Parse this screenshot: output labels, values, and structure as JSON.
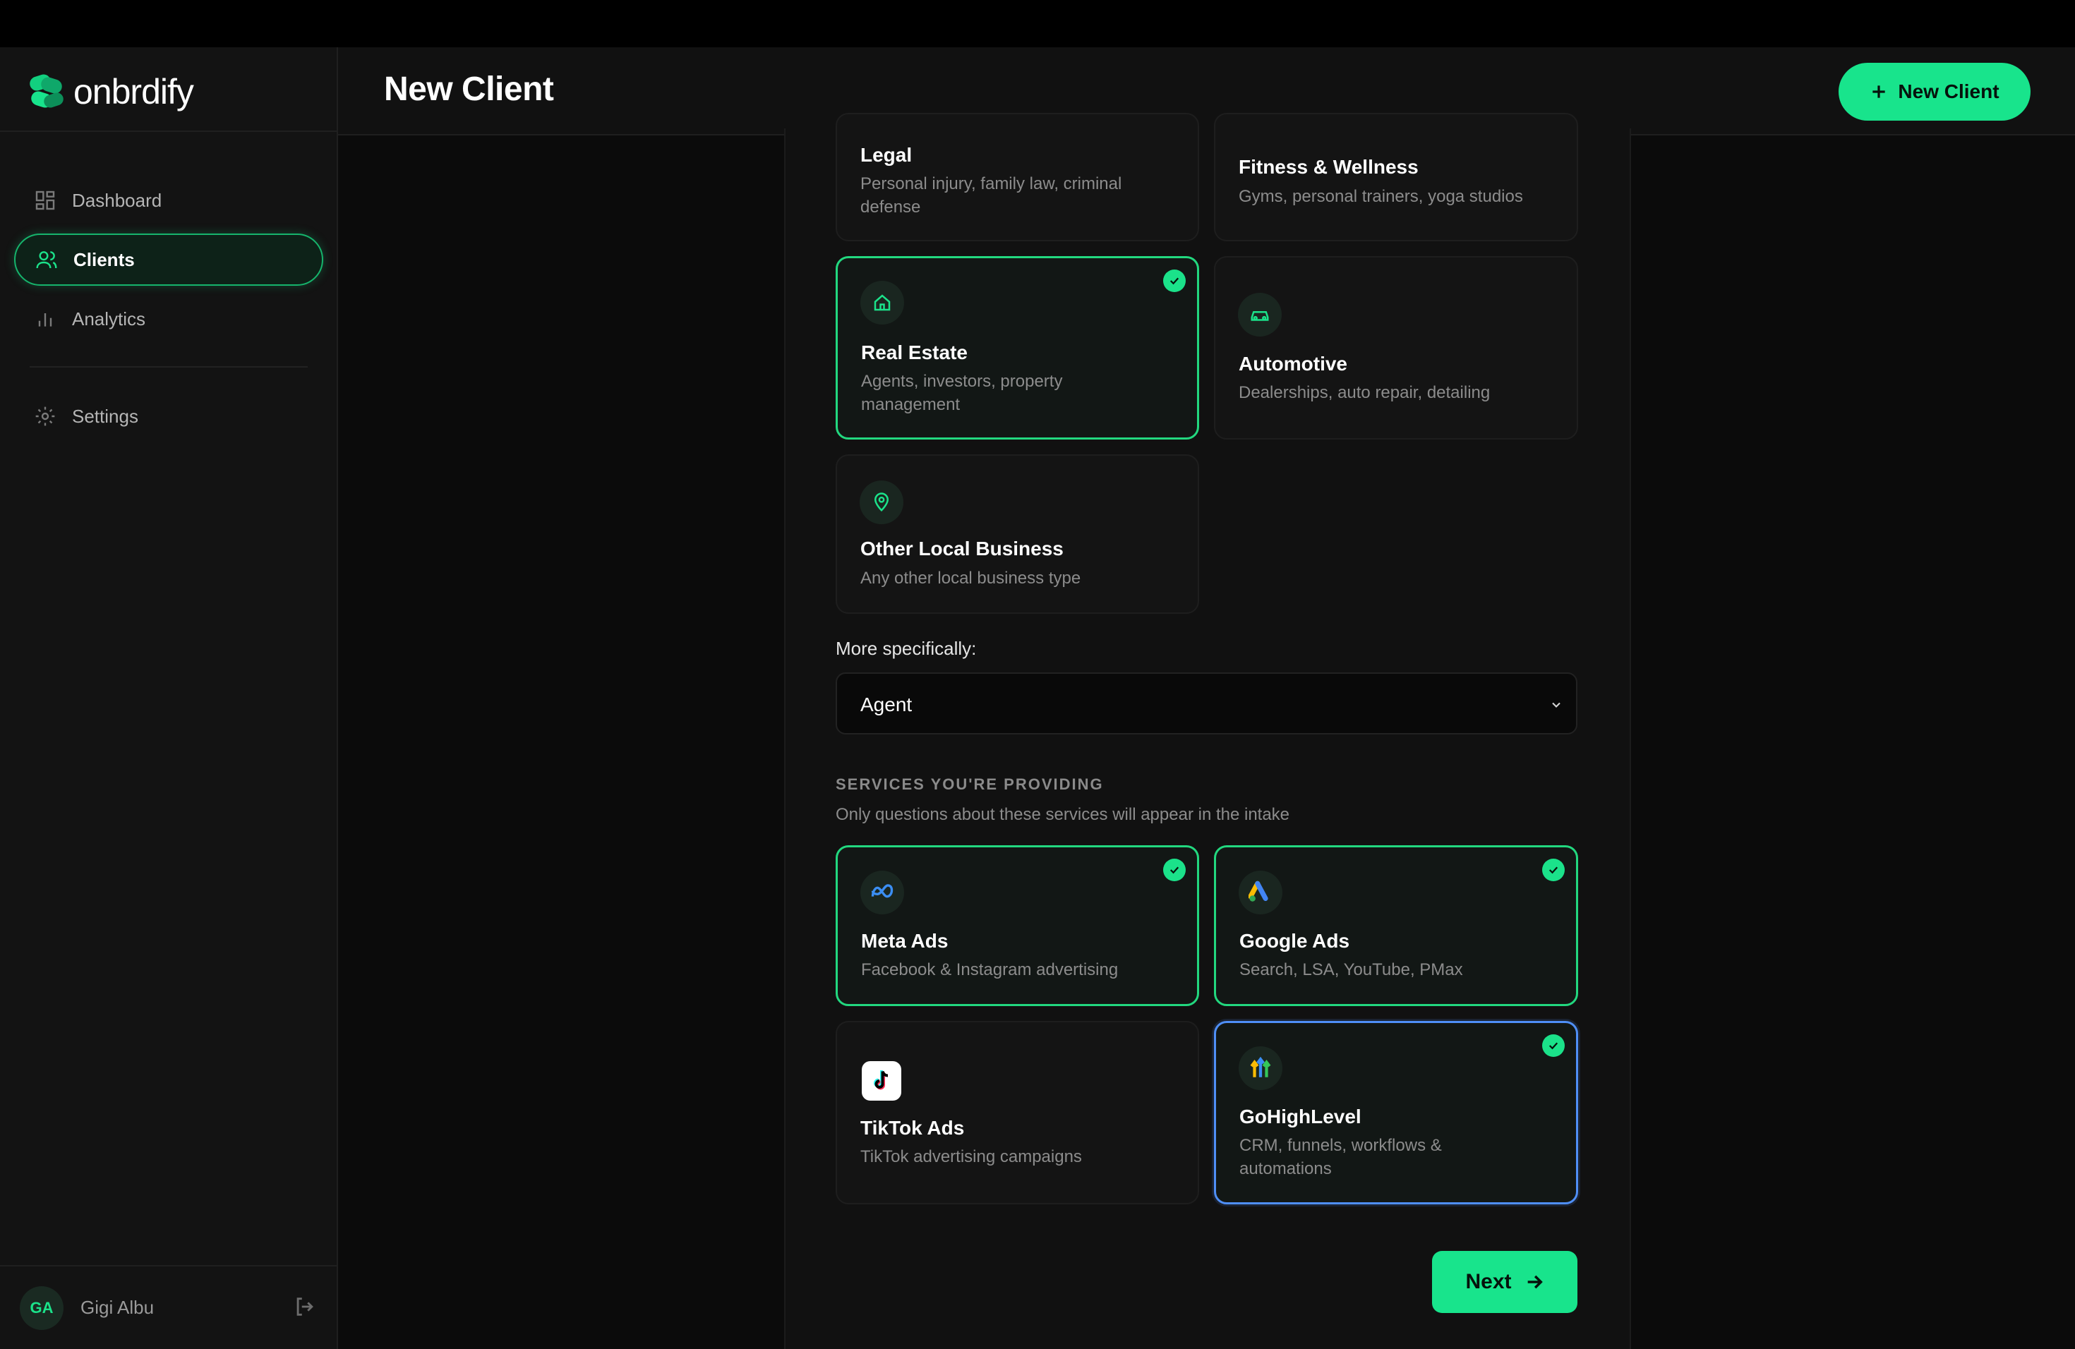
{
  "app": {
    "logo_text": "onbrdify"
  },
  "sidebar": {
    "items": [
      {
        "label": "Dashboard",
        "icon": "grid-icon"
      },
      {
        "label": "Clients",
        "icon": "users-icon",
        "active": true
      },
      {
        "label": "Analytics",
        "icon": "bar-chart-icon"
      },
      {
        "label": "Settings",
        "icon": "gear-icon"
      }
    ],
    "user": {
      "initials": "GA",
      "name": "Gigi Albu"
    }
  },
  "header": {
    "title": "New Client",
    "new_client_button": "New Client"
  },
  "industries": [
    {
      "title": "Legal",
      "desc": "Personal injury, family law, criminal defense",
      "selected": false
    },
    {
      "title": "Fitness & Wellness",
      "desc": "Gyms, personal trainers, yoga studios",
      "selected": false
    },
    {
      "title": "Real Estate",
      "desc": "Agents, investors, property management",
      "selected": true,
      "icon": "home-icon"
    },
    {
      "title": "Automotive",
      "desc": "Dealerships, auto repair, detailing",
      "selected": false,
      "icon": "car-icon"
    },
    {
      "title": "Other Local Business",
      "desc": "Any other local business type",
      "selected": false,
      "icon": "map-pin-icon"
    }
  ],
  "specific": {
    "label": "More specifically:",
    "value": "Agent"
  },
  "services": {
    "heading": "SERVICES YOU'RE PROVIDING",
    "subheading": "Only questions about these services will appear in the intake",
    "items": [
      {
        "title": "Meta Ads",
        "desc": "Facebook & Instagram advertising",
        "selected": true,
        "icon": "meta-icon"
      },
      {
        "title": "Google Ads",
        "desc": "Search, LSA, YouTube, PMax",
        "selected": true,
        "icon": "google-ads-icon"
      },
      {
        "title": "TikTok Ads",
        "desc": "TikTok advertising campaigns",
        "selected": false,
        "icon": "tiktok-icon"
      },
      {
        "title": "GoHighLevel",
        "desc": "CRM, funnels, workflows & automations",
        "selected": true,
        "focused": true,
        "icon": "gohighlevel-icon"
      }
    ]
  },
  "footer": {
    "next_button": "Next"
  },
  "colors": {
    "accent": "#18e48c",
    "focus": "#4f8ff7",
    "background": "#0b0b0b"
  }
}
